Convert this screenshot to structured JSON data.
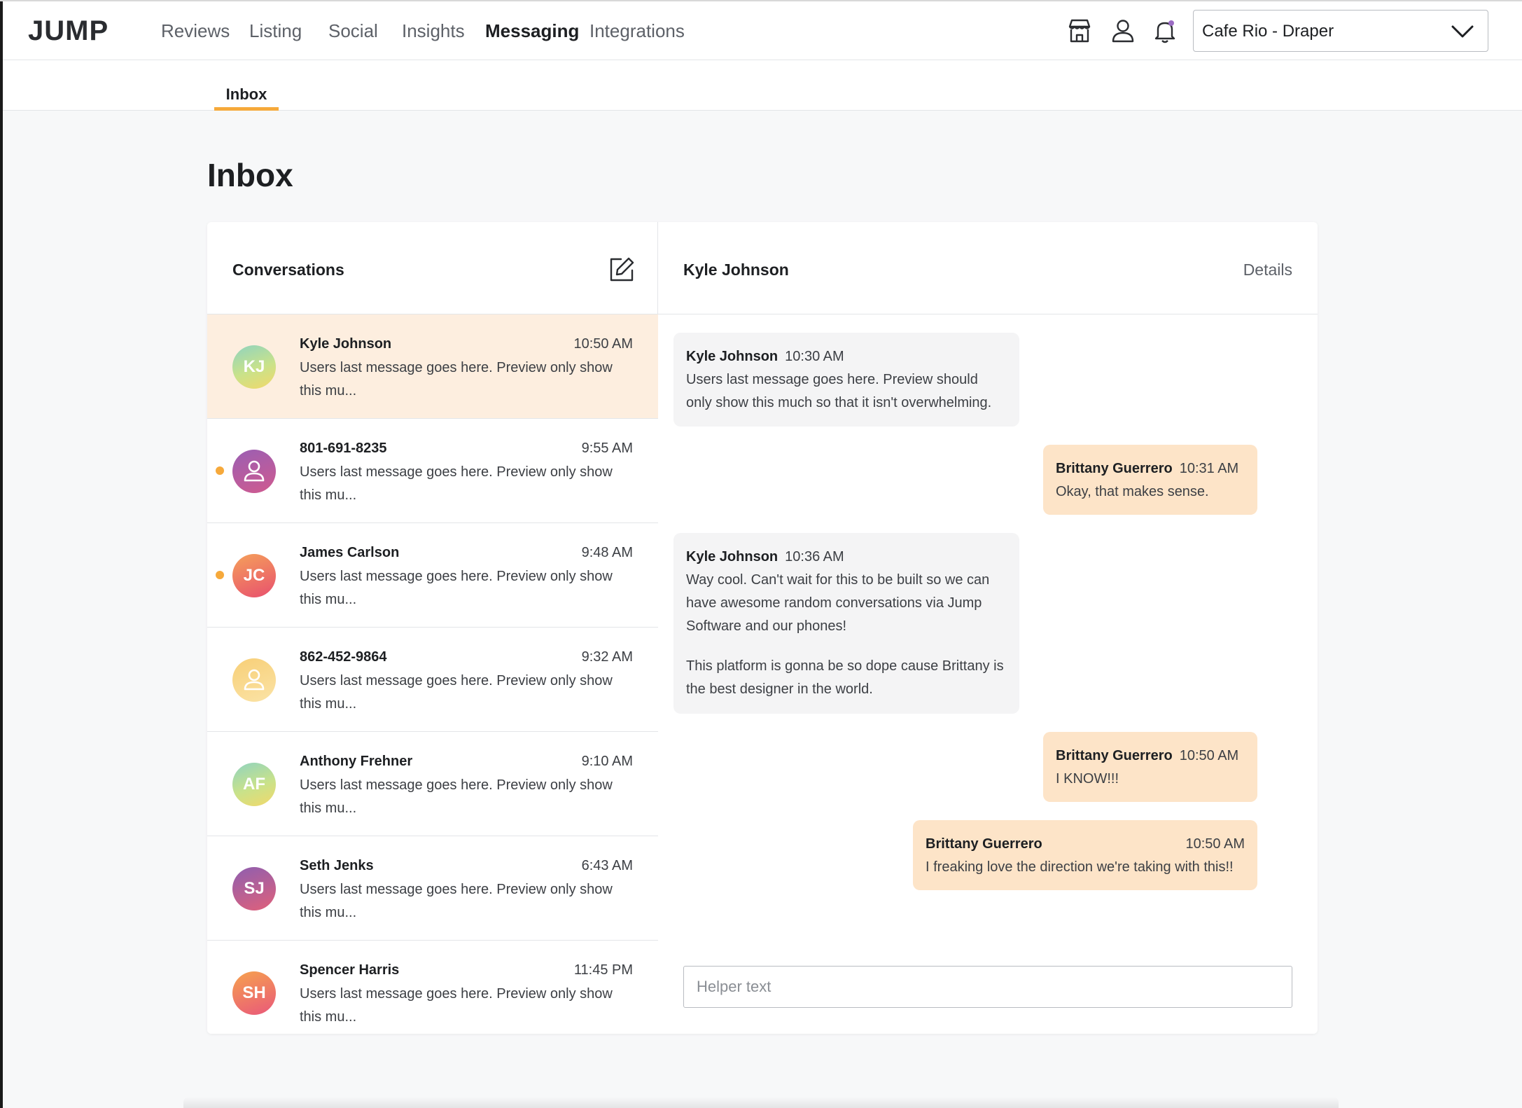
{
  "nav": {
    "logo": "JUMP",
    "links": [
      "Reviews",
      "Listing",
      "Social",
      "Insights",
      "Messaging",
      "Integrations"
    ],
    "active": "Messaging",
    "icons": [
      "storefront-icon",
      "user-icon",
      "bell-icon"
    ],
    "location": "Cafe Rio - Draper"
  },
  "subnav": {
    "tab": "Inbox"
  },
  "page": {
    "title": "Inbox"
  },
  "conversations": {
    "title": "Conversations",
    "items": [
      {
        "name": "Kyle Johnson",
        "time": "10:50 AM",
        "initials": "KJ",
        "preview": "Users last message goes here. Preview only show this mu...",
        "unread": false,
        "selected": true
      },
      {
        "name": "801-691-8235",
        "time": "9:55 AM",
        "initials": "",
        "preview": "Users last message goes here. Preview only show this mu...",
        "unread": true,
        "selected": false
      },
      {
        "name": "James Carlson",
        "time": "9:48 AM",
        "initials": "JC",
        "preview": "Users last message goes here. Preview only show this mu...",
        "unread": true,
        "selected": false
      },
      {
        "name": "862-452-9864",
        "time": "9:32 AM",
        "initials": "",
        "preview": "Users last message goes here. Preview only show this mu...",
        "unread": false,
        "selected": false
      },
      {
        "name": "Anthony Frehner",
        "time": "9:10 AM",
        "initials": "AF",
        "preview": "Users last message goes here. Preview only show this mu...",
        "unread": false,
        "selected": false
      },
      {
        "name": "Seth Jenks",
        "time": "6:43 AM",
        "initials": "SJ",
        "preview": "Users last message goes here. Preview only show this mu...",
        "unread": false,
        "selected": false
      },
      {
        "name": "Spencer Harris",
        "time": "11:45 PM",
        "initials": "SH",
        "preview": "Users last message goes here. Preview only show this mu...",
        "unread": false,
        "selected": false
      }
    ]
  },
  "thread": {
    "title": "Kyle Johnson",
    "details_label": "Details",
    "messages": [
      {
        "sender": "Kyle Johnson",
        "time": "10:30 AM",
        "direction": "in",
        "paragraphs": [
          "Users last message goes here. Preview should only show this much so that it isn't overwhelming."
        ]
      },
      {
        "sender": "Brittany Guerrero",
        "time": "10:31 AM",
        "direction": "out",
        "paragraphs": [
          "Okay, that makes sense."
        ]
      },
      {
        "sender": "Kyle Johnson",
        "time": "10:36 AM",
        "direction": "in",
        "paragraphs": [
          "Way cool. Can't wait for this to be built so we can have awesome random conversations via Jump Software and our phones!",
          "This platform is gonna be so dope cause Brittany is the best designer in the world."
        ]
      },
      {
        "sender": "Brittany Guerrero",
        "time": "10:50 AM",
        "direction": "out",
        "paragraphs": [
          "I KNOW!!!"
        ]
      },
      {
        "sender": "Brittany Guerrero",
        "time": "10:50 AM",
        "direction": "out",
        "paragraphs": [
          "I freaking love the direction we're taking with this!!"
        ]
      }
    ],
    "input_placeholder": "Helper text"
  },
  "colors": {
    "accent": "#f6a93b",
    "selected_row": "#fdeedf",
    "outgoing_bubble": "#fde4c8",
    "incoming_bubble": "#f4f4f5"
  }
}
